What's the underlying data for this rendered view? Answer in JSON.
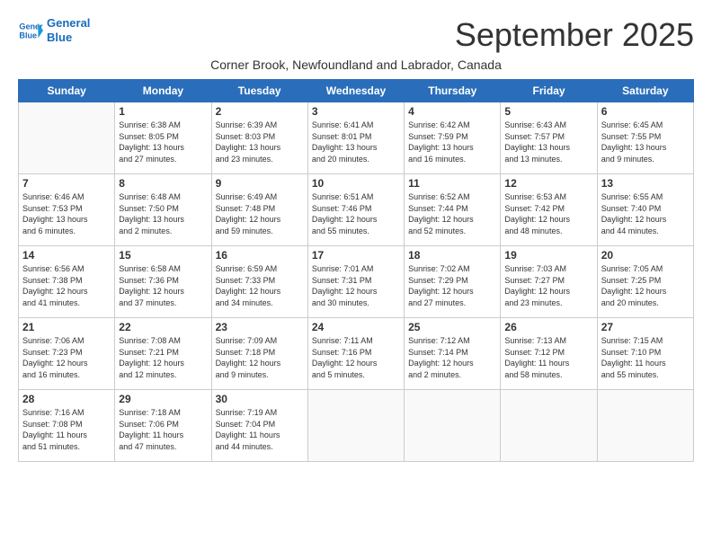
{
  "logo": {
    "line1": "General",
    "line2": "Blue"
  },
  "title": "September 2025",
  "subtitle": "Corner Brook, Newfoundland and Labrador, Canada",
  "weekdays": [
    "Sunday",
    "Monday",
    "Tuesday",
    "Wednesday",
    "Thursday",
    "Friday",
    "Saturday"
  ],
  "weeks": [
    [
      {
        "day": "",
        "info": ""
      },
      {
        "day": "1",
        "info": "Sunrise: 6:38 AM\nSunset: 8:05 PM\nDaylight: 13 hours\nand 27 minutes."
      },
      {
        "day": "2",
        "info": "Sunrise: 6:39 AM\nSunset: 8:03 PM\nDaylight: 13 hours\nand 23 minutes."
      },
      {
        "day": "3",
        "info": "Sunrise: 6:41 AM\nSunset: 8:01 PM\nDaylight: 13 hours\nand 20 minutes."
      },
      {
        "day": "4",
        "info": "Sunrise: 6:42 AM\nSunset: 7:59 PM\nDaylight: 13 hours\nand 16 minutes."
      },
      {
        "day": "5",
        "info": "Sunrise: 6:43 AM\nSunset: 7:57 PM\nDaylight: 13 hours\nand 13 minutes."
      },
      {
        "day": "6",
        "info": "Sunrise: 6:45 AM\nSunset: 7:55 PM\nDaylight: 13 hours\nand 9 minutes."
      }
    ],
    [
      {
        "day": "7",
        "info": "Sunrise: 6:46 AM\nSunset: 7:53 PM\nDaylight: 13 hours\nand 6 minutes."
      },
      {
        "day": "8",
        "info": "Sunrise: 6:48 AM\nSunset: 7:50 PM\nDaylight: 13 hours\nand 2 minutes."
      },
      {
        "day": "9",
        "info": "Sunrise: 6:49 AM\nSunset: 7:48 PM\nDaylight: 12 hours\nand 59 minutes."
      },
      {
        "day": "10",
        "info": "Sunrise: 6:51 AM\nSunset: 7:46 PM\nDaylight: 12 hours\nand 55 minutes."
      },
      {
        "day": "11",
        "info": "Sunrise: 6:52 AM\nSunset: 7:44 PM\nDaylight: 12 hours\nand 52 minutes."
      },
      {
        "day": "12",
        "info": "Sunrise: 6:53 AM\nSunset: 7:42 PM\nDaylight: 12 hours\nand 48 minutes."
      },
      {
        "day": "13",
        "info": "Sunrise: 6:55 AM\nSunset: 7:40 PM\nDaylight: 12 hours\nand 44 minutes."
      }
    ],
    [
      {
        "day": "14",
        "info": "Sunrise: 6:56 AM\nSunset: 7:38 PM\nDaylight: 12 hours\nand 41 minutes."
      },
      {
        "day": "15",
        "info": "Sunrise: 6:58 AM\nSunset: 7:36 PM\nDaylight: 12 hours\nand 37 minutes."
      },
      {
        "day": "16",
        "info": "Sunrise: 6:59 AM\nSunset: 7:33 PM\nDaylight: 12 hours\nand 34 minutes."
      },
      {
        "day": "17",
        "info": "Sunrise: 7:01 AM\nSunset: 7:31 PM\nDaylight: 12 hours\nand 30 minutes."
      },
      {
        "day": "18",
        "info": "Sunrise: 7:02 AM\nSunset: 7:29 PM\nDaylight: 12 hours\nand 27 minutes."
      },
      {
        "day": "19",
        "info": "Sunrise: 7:03 AM\nSunset: 7:27 PM\nDaylight: 12 hours\nand 23 minutes."
      },
      {
        "day": "20",
        "info": "Sunrise: 7:05 AM\nSunset: 7:25 PM\nDaylight: 12 hours\nand 20 minutes."
      }
    ],
    [
      {
        "day": "21",
        "info": "Sunrise: 7:06 AM\nSunset: 7:23 PM\nDaylight: 12 hours\nand 16 minutes."
      },
      {
        "day": "22",
        "info": "Sunrise: 7:08 AM\nSunset: 7:21 PM\nDaylight: 12 hours\nand 12 minutes."
      },
      {
        "day": "23",
        "info": "Sunrise: 7:09 AM\nSunset: 7:18 PM\nDaylight: 12 hours\nand 9 minutes."
      },
      {
        "day": "24",
        "info": "Sunrise: 7:11 AM\nSunset: 7:16 PM\nDaylight: 12 hours\nand 5 minutes."
      },
      {
        "day": "25",
        "info": "Sunrise: 7:12 AM\nSunset: 7:14 PM\nDaylight: 12 hours\nand 2 minutes."
      },
      {
        "day": "26",
        "info": "Sunrise: 7:13 AM\nSunset: 7:12 PM\nDaylight: 11 hours\nand 58 minutes."
      },
      {
        "day": "27",
        "info": "Sunrise: 7:15 AM\nSunset: 7:10 PM\nDaylight: 11 hours\nand 55 minutes."
      }
    ],
    [
      {
        "day": "28",
        "info": "Sunrise: 7:16 AM\nSunset: 7:08 PM\nDaylight: 11 hours\nand 51 minutes."
      },
      {
        "day": "29",
        "info": "Sunrise: 7:18 AM\nSunset: 7:06 PM\nDaylight: 11 hours\nand 47 minutes."
      },
      {
        "day": "30",
        "info": "Sunrise: 7:19 AM\nSunset: 7:04 PM\nDaylight: 11 hours\nand 44 minutes."
      },
      {
        "day": "",
        "info": ""
      },
      {
        "day": "",
        "info": ""
      },
      {
        "day": "",
        "info": ""
      },
      {
        "day": "",
        "info": ""
      }
    ]
  ]
}
